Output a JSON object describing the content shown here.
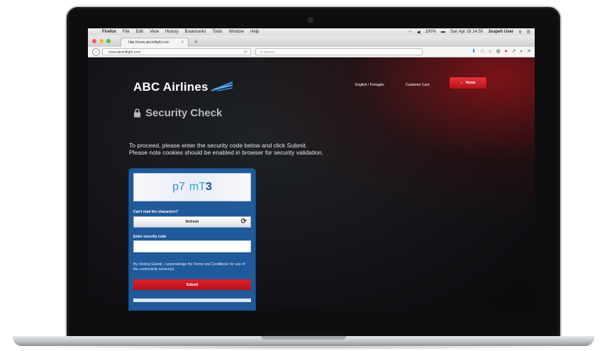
{
  "macbar": {
    "app": "Firefox",
    "menus": [
      "File",
      "Edit",
      "View",
      "History",
      "Bookmarks",
      "Tools",
      "Window",
      "Help"
    ],
    "battery": "100%",
    "datetime": "Sun Apr 18 14:50",
    "user": "Jospeh User"
  },
  "browser": {
    "tab_title": "http://www.abcinflight.com",
    "url": "www.abcinflight.com",
    "search_placeholder": "Search"
  },
  "site": {
    "logo": "ABC Airlines",
    "language_link": "English / Portugês",
    "customer_care_link": "Customer Care",
    "home_button": "Home",
    "page_title": "Security Check",
    "instruction_line1": "To proceed, please enter the security code below and click Submit.",
    "instruction_line2": "Please note cookies should be enabled in browser for security validation."
  },
  "captcha": {
    "chars_1": "p7",
    "chars_2": "mT",
    "chars_3": "3",
    "cant_read_label": "Can't read the characters?",
    "refresh_label": "Refresh",
    "enter_code_label": "Enter security code",
    "code_value": "",
    "terms_text": "By clicking Submit, I acknowledge the Terms and Conditions¹ for use of the connectivity service(s)",
    "submit_label": "Submit"
  },
  "colors": {
    "brand_red": "#c8141d",
    "panel_blue": "#1e5a9c"
  }
}
